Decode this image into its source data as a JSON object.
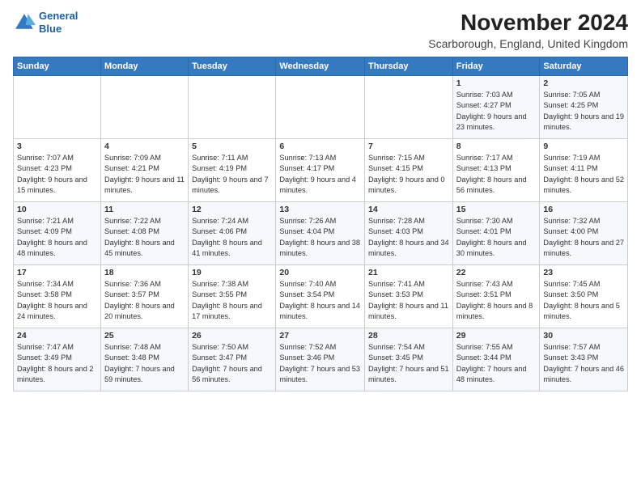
{
  "logo": {
    "line1": "General",
    "line2": "Blue"
  },
  "title": "November 2024",
  "subtitle": "Scarborough, England, United Kingdom",
  "days_of_week": [
    "Sunday",
    "Monday",
    "Tuesday",
    "Wednesday",
    "Thursday",
    "Friday",
    "Saturday"
  ],
  "weeks": [
    [
      {
        "day": "",
        "info": ""
      },
      {
        "day": "",
        "info": ""
      },
      {
        "day": "",
        "info": ""
      },
      {
        "day": "",
        "info": ""
      },
      {
        "day": "",
        "info": ""
      },
      {
        "day": "1",
        "info": "Sunrise: 7:03 AM\nSunset: 4:27 PM\nDaylight: 9 hours and 23 minutes."
      },
      {
        "day": "2",
        "info": "Sunrise: 7:05 AM\nSunset: 4:25 PM\nDaylight: 9 hours and 19 minutes."
      }
    ],
    [
      {
        "day": "3",
        "info": "Sunrise: 7:07 AM\nSunset: 4:23 PM\nDaylight: 9 hours and 15 minutes."
      },
      {
        "day": "4",
        "info": "Sunrise: 7:09 AM\nSunset: 4:21 PM\nDaylight: 9 hours and 11 minutes."
      },
      {
        "day": "5",
        "info": "Sunrise: 7:11 AM\nSunset: 4:19 PM\nDaylight: 9 hours and 7 minutes."
      },
      {
        "day": "6",
        "info": "Sunrise: 7:13 AM\nSunset: 4:17 PM\nDaylight: 9 hours and 4 minutes."
      },
      {
        "day": "7",
        "info": "Sunrise: 7:15 AM\nSunset: 4:15 PM\nDaylight: 9 hours and 0 minutes."
      },
      {
        "day": "8",
        "info": "Sunrise: 7:17 AM\nSunset: 4:13 PM\nDaylight: 8 hours and 56 minutes."
      },
      {
        "day": "9",
        "info": "Sunrise: 7:19 AM\nSunset: 4:11 PM\nDaylight: 8 hours and 52 minutes."
      }
    ],
    [
      {
        "day": "10",
        "info": "Sunrise: 7:21 AM\nSunset: 4:09 PM\nDaylight: 8 hours and 48 minutes."
      },
      {
        "day": "11",
        "info": "Sunrise: 7:22 AM\nSunset: 4:08 PM\nDaylight: 8 hours and 45 minutes."
      },
      {
        "day": "12",
        "info": "Sunrise: 7:24 AM\nSunset: 4:06 PM\nDaylight: 8 hours and 41 minutes."
      },
      {
        "day": "13",
        "info": "Sunrise: 7:26 AM\nSunset: 4:04 PM\nDaylight: 8 hours and 38 minutes."
      },
      {
        "day": "14",
        "info": "Sunrise: 7:28 AM\nSunset: 4:03 PM\nDaylight: 8 hours and 34 minutes."
      },
      {
        "day": "15",
        "info": "Sunrise: 7:30 AM\nSunset: 4:01 PM\nDaylight: 8 hours and 30 minutes."
      },
      {
        "day": "16",
        "info": "Sunrise: 7:32 AM\nSunset: 4:00 PM\nDaylight: 8 hours and 27 minutes."
      }
    ],
    [
      {
        "day": "17",
        "info": "Sunrise: 7:34 AM\nSunset: 3:58 PM\nDaylight: 8 hours and 24 minutes."
      },
      {
        "day": "18",
        "info": "Sunrise: 7:36 AM\nSunset: 3:57 PM\nDaylight: 8 hours and 20 minutes."
      },
      {
        "day": "19",
        "info": "Sunrise: 7:38 AM\nSunset: 3:55 PM\nDaylight: 8 hours and 17 minutes."
      },
      {
        "day": "20",
        "info": "Sunrise: 7:40 AM\nSunset: 3:54 PM\nDaylight: 8 hours and 14 minutes."
      },
      {
        "day": "21",
        "info": "Sunrise: 7:41 AM\nSunset: 3:53 PM\nDaylight: 8 hours and 11 minutes."
      },
      {
        "day": "22",
        "info": "Sunrise: 7:43 AM\nSunset: 3:51 PM\nDaylight: 8 hours and 8 minutes."
      },
      {
        "day": "23",
        "info": "Sunrise: 7:45 AM\nSunset: 3:50 PM\nDaylight: 8 hours and 5 minutes."
      }
    ],
    [
      {
        "day": "24",
        "info": "Sunrise: 7:47 AM\nSunset: 3:49 PM\nDaylight: 8 hours and 2 minutes."
      },
      {
        "day": "25",
        "info": "Sunrise: 7:48 AM\nSunset: 3:48 PM\nDaylight: 7 hours and 59 minutes."
      },
      {
        "day": "26",
        "info": "Sunrise: 7:50 AM\nSunset: 3:47 PM\nDaylight: 7 hours and 56 minutes."
      },
      {
        "day": "27",
        "info": "Sunrise: 7:52 AM\nSunset: 3:46 PM\nDaylight: 7 hours and 53 minutes."
      },
      {
        "day": "28",
        "info": "Sunrise: 7:54 AM\nSunset: 3:45 PM\nDaylight: 7 hours and 51 minutes."
      },
      {
        "day": "29",
        "info": "Sunrise: 7:55 AM\nSunset: 3:44 PM\nDaylight: 7 hours and 48 minutes."
      },
      {
        "day": "30",
        "info": "Sunrise: 7:57 AM\nSunset: 3:43 PM\nDaylight: 7 hours and 46 minutes."
      }
    ]
  ]
}
